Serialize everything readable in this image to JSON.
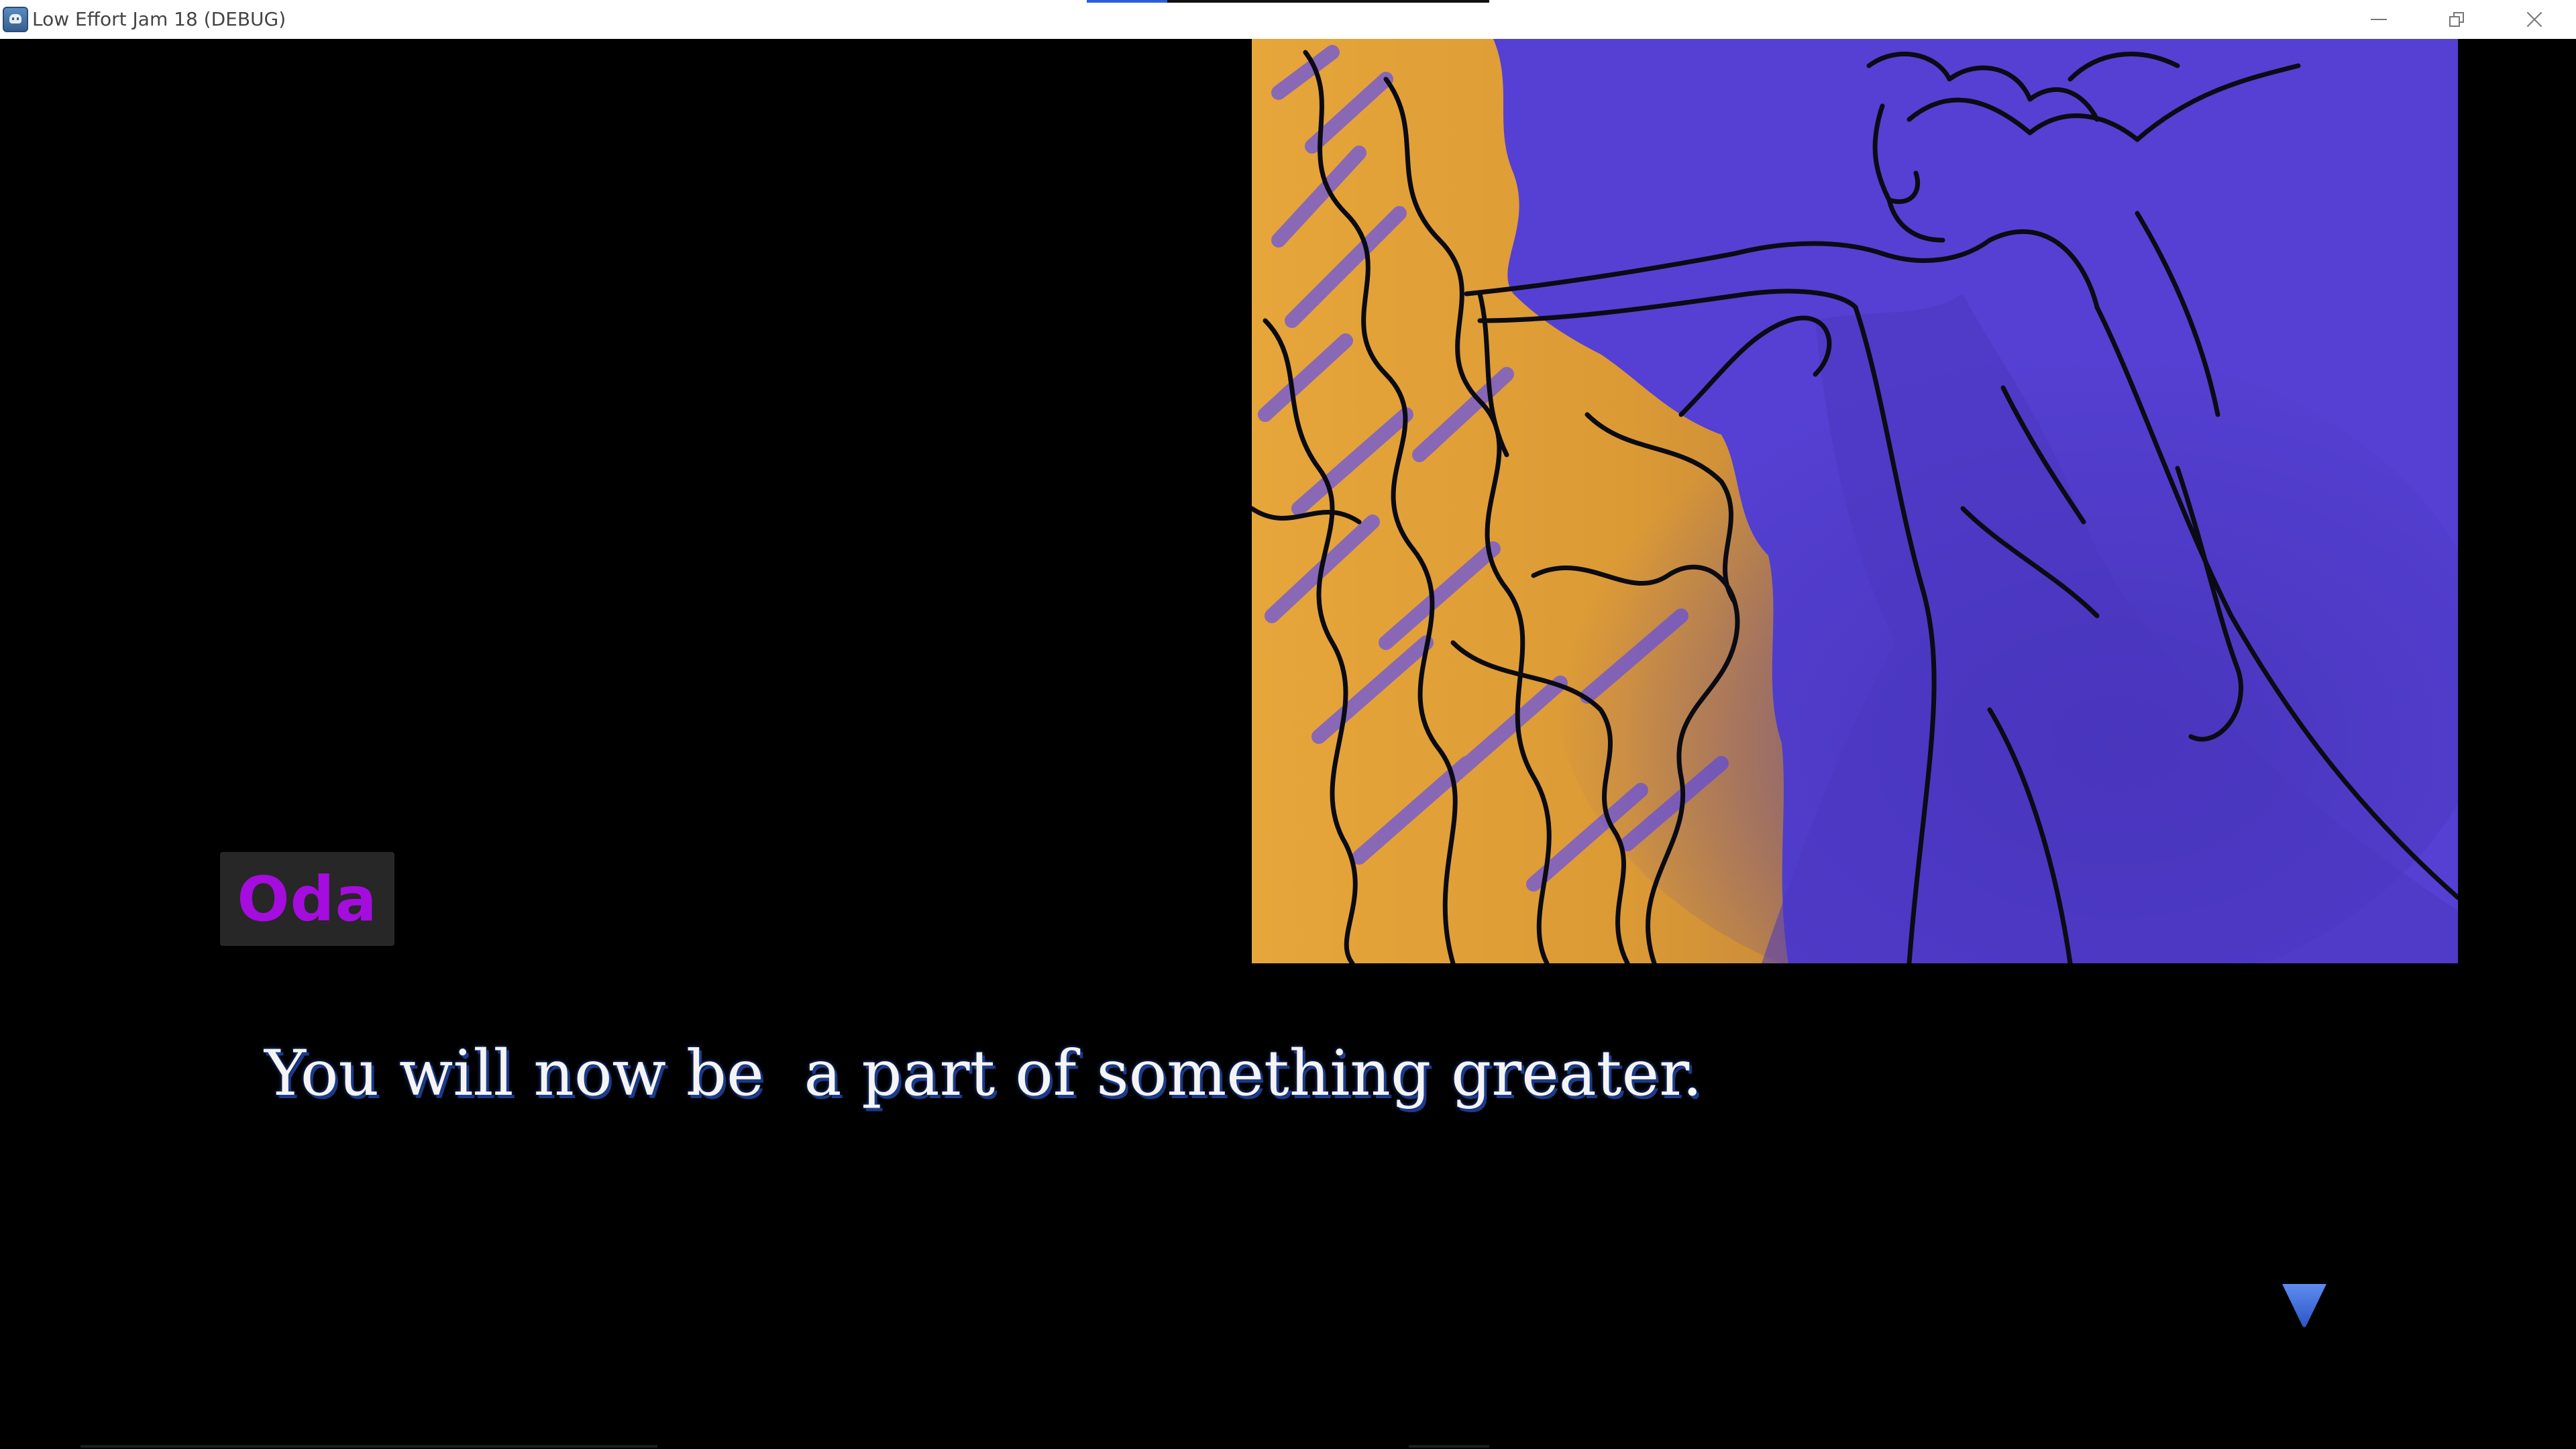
{
  "window": {
    "title": "Low Effort Jam 18 (DEBUG)",
    "icon": "godot-engine-icon",
    "controls": [
      "minimize-icon",
      "restore-icon",
      "close-icon"
    ],
    "loading_progress": 0.2
  },
  "scene": {
    "illustration": "character-casting-spell-illustration",
    "colors": {
      "background": "#000000",
      "illustration_fill": "#5540d3",
      "fire_fill": "#e3a23a",
      "outline": "#0b0b14"
    }
  },
  "dialogue": {
    "speaker": "Oda",
    "speaker_color": "#a50cde",
    "nameplate_color": "#272727",
    "text": "You will now be  a part of something greater.",
    "text_color": "#f4f4f4",
    "shadow_color": "#1b3a8a"
  },
  "continue_indicator": {
    "icon": "triangle-down-icon",
    "color": "#3f6fd6"
  }
}
